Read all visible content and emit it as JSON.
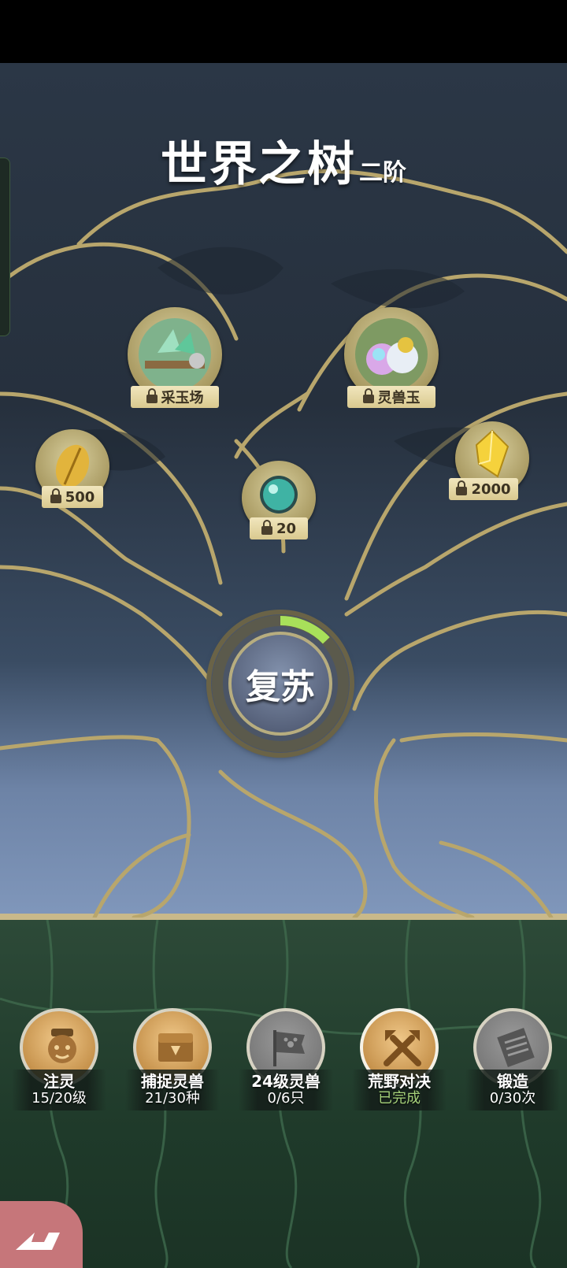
{
  "title": {
    "main": "世界之树",
    "sub": "二阶"
  },
  "nodes": [
    {
      "id": "jade-field",
      "label": "采玉场",
      "icon": "jade-field-scene-icon"
    },
    {
      "id": "beast-jade",
      "label": "灵兽玉",
      "icon": "beast-jade-orbs-icon"
    },
    {
      "id": "gold-leaf",
      "label": "500",
      "icon": "gold-leaf-coin-icon"
    },
    {
      "id": "spirit-orb",
      "label": "20",
      "icon": "spirit-orb-icon"
    },
    {
      "id": "crystal",
      "label": "2000",
      "icon": "gold-crystal-icon"
    }
  ],
  "revive": {
    "label": "复苏",
    "progress_fraction": 0.13
  },
  "tasks": [
    {
      "name": "注灵",
      "progress": "15/20级",
      "icon": "mask-face-icon",
      "style": "gold",
      "done": false
    },
    {
      "name": "捕捉灵兽",
      "progress": "21/30种",
      "icon": "book-box-icon",
      "style": "gold",
      "done": false
    },
    {
      "name": "24级灵兽",
      "progress": "0/6只",
      "icon": "paw-flag-icon",
      "style": "grey",
      "done": false
    },
    {
      "name": "荒野对决",
      "progress": "已完成",
      "icon": "crossed-weapons-icon",
      "style": "gold",
      "done": true
    },
    {
      "name": "锻造",
      "progress": "0/30次",
      "icon": "scroll-icon",
      "style": "grey",
      "done": false
    }
  ],
  "colors": {
    "gold_line": "#b8a66c",
    "done_text": "#a6d27a",
    "corner_button": "#c6767a"
  }
}
